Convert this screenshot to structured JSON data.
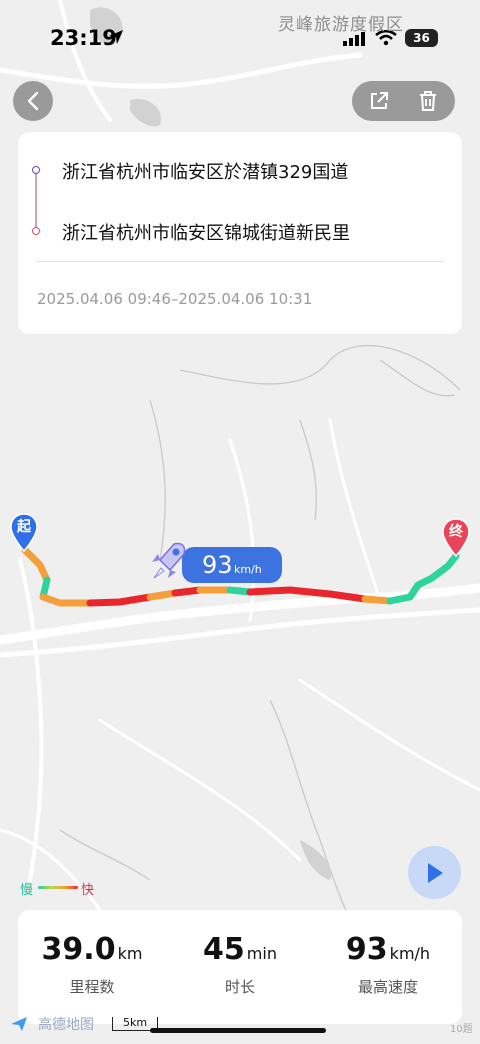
{
  "status_bar": {
    "time": "23:19",
    "battery": "36"
  },
  "map": {
    "poi_label": "灵峰旅游度假区",
    "start_marker": "起",
    "end_marker": "终",
    "speed_tag": {
      "value": "93",
      "unit": "km/h"
    },
    "legend": {
      "slow": "慢",
      "fast": "快"
    },
    "scale": "5km",
    "brand": "高德地图",
    "corner_mark": "10题",
    "colors": {
      "fast": "#e8262b",
      "medium": "#f59f3a",
      "slow": "#2fd39c",
      "start": "#2f6fe8",
      "end": "#e8455a"
    }
  },
  "trip": {
    "start_address": "浙江省杭州市临安区於潜镇329国道",
    "end_address": "浙江省杭州市临安区锦城街道新民里",
    "time_range": "2025.04.06 09:46–2025.04.06 10:31"
  },
  "stats": [
    {
      "value": "39.0",
      "unit": "km",
      "label": "里程数"
    },
    {
      "value": "45",
      "unit": "min",
      "label": "时长"
    },
    {
      "value": "93",
      "unit": "km/h",
      "label": "最高速度"
    }
  ],
  "icons": {
    "back": "chevron-left-icon",
    "share": "share-icon",
    "delete": "trash-icon",
    "play": "play-icon",
    "rocket": "rocket-icon"
  }
}
